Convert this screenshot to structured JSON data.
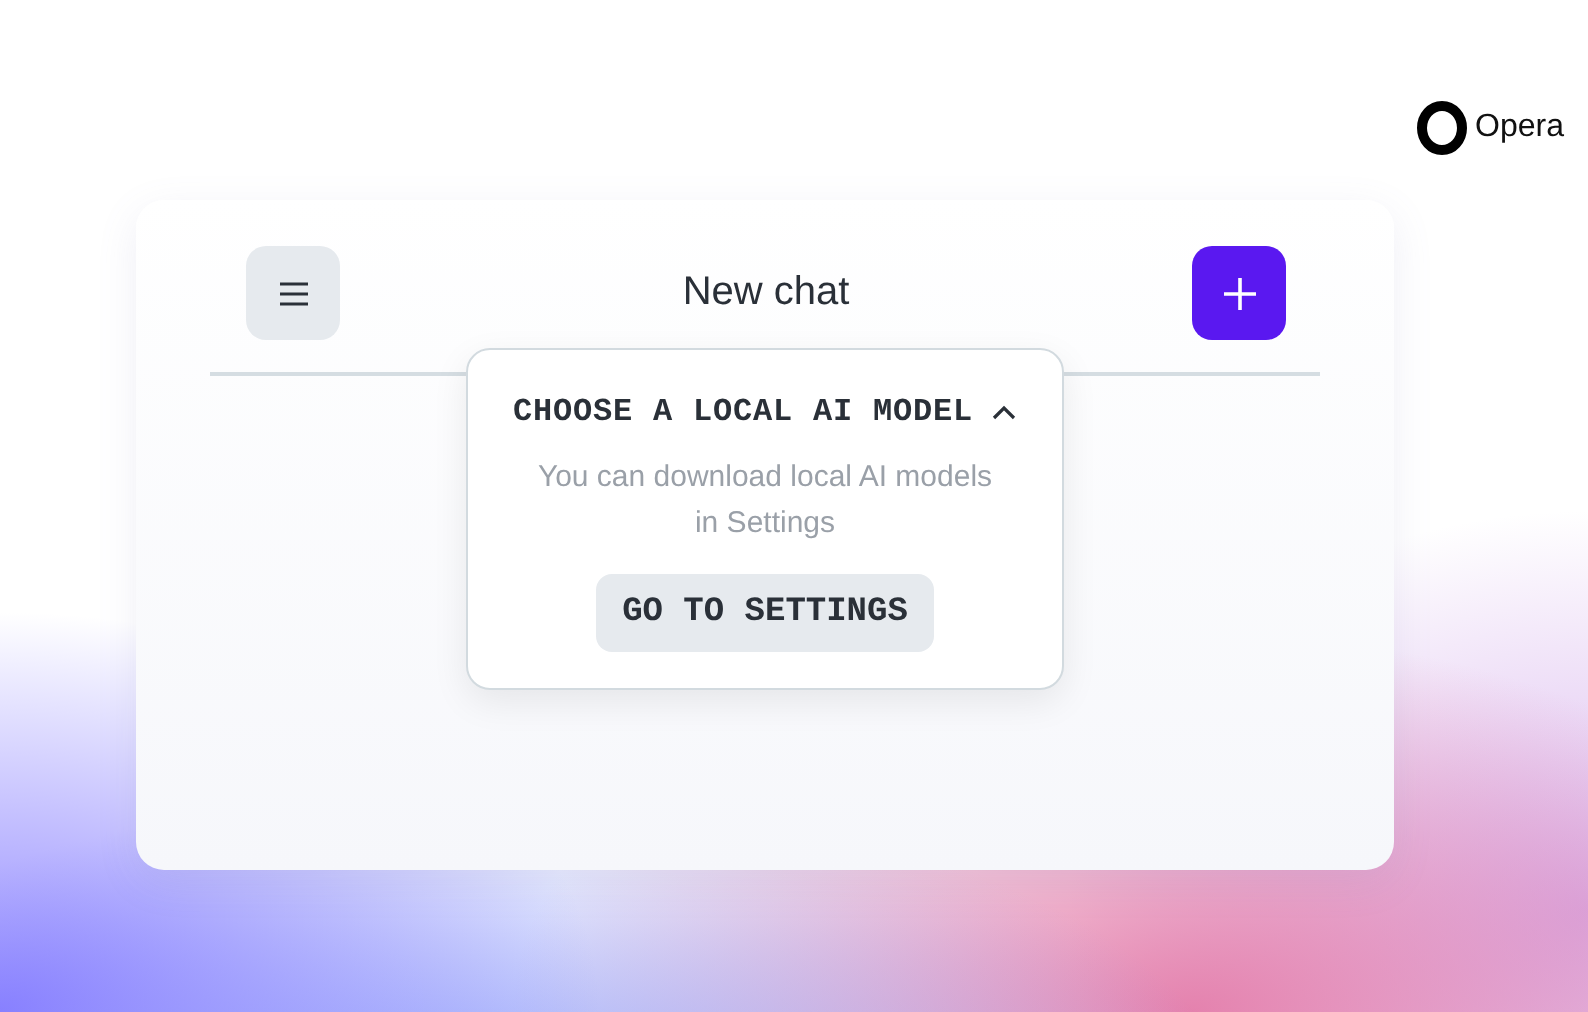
{
  "brand": {
    "name": "Opera"
  },
  "chat": {
    "title": "New chat"
  },
  "model_popover": {
    "title": "CHOOSE A LOCAL AI MODEL",
    "expanded": true,
    "message": "You can download local AI models in Settings",
    "button": "GO TO SETTINGS"
  }
}
